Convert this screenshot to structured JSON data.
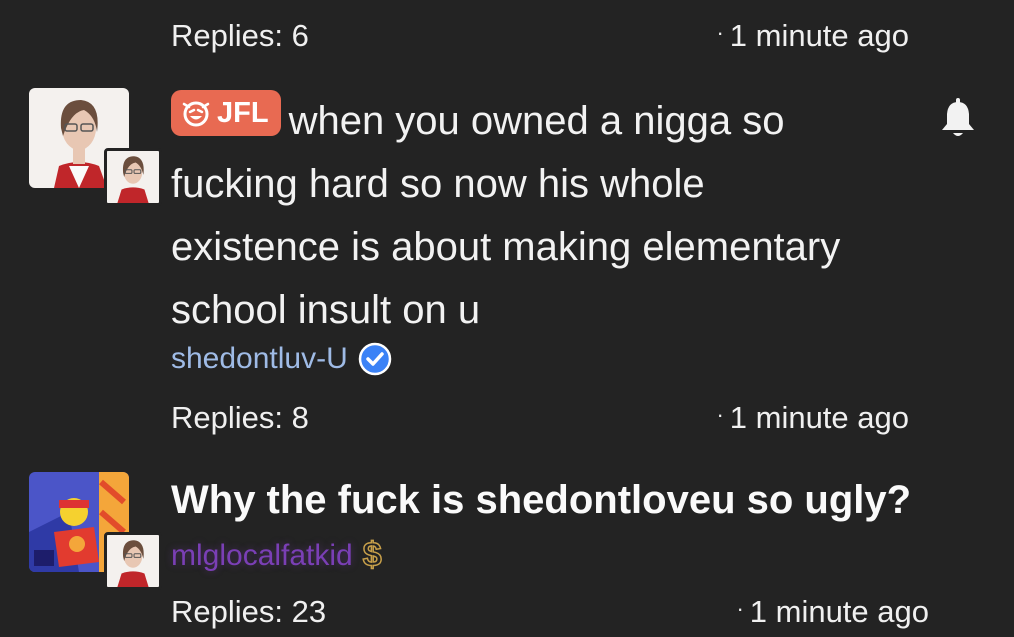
{
  "top_meta": {
    "replies": "Replies: 6",
    "time": "1 minute ago"
  },
  "comment1": {
    "tag": "JFL",
    "text_lines": [
      "when you owned a nigga so",
      "fucking hard so now his whole",
      "existence is about making elementary",
      "school insult on u"
    ],
    "author": "shedontluv-U",
    "author_color": "#9fbbe6",
    "badge": "verified-check-icon",
    "replies": "Replies: 8",
    "time": "1 minute ago"
  },
  "comment2": {
    "text": "Why the fuck is shedontloveu so ugly?",
    "author": "mlglocalfatkid",
    "author_color": "#7a3fb5",
    "badge_symbol": "$",
    "replies": "Replies: 23",
    "time": "1 minute ago"
  },
  "colors": {
    "background": "#232323",
    "tag": "#e86a52",
    "verified": "#3b82f6",
    "money": "#c8a04a"
  }
}
